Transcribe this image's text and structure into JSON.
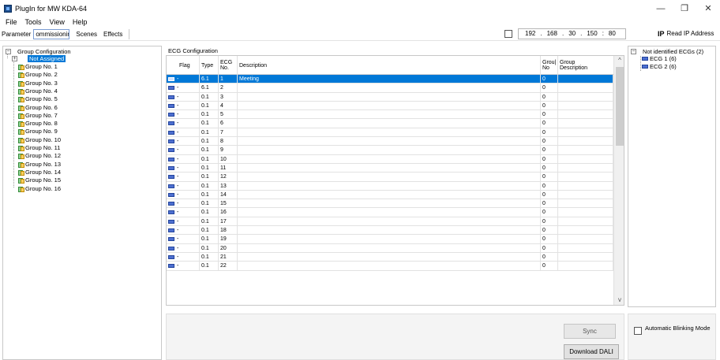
{
  "window": {
    "title": "PlugIn for MW KDA-64",
    "minimize": "—",
    "maximize": "❐",
    "close": "✕"
  },
  "menu": [
    "File",
    "Tools",
    "View",
    "Help"
  ],
  "toolbar": {
    "parameter_label": "Parameter",
    "combo_value": "ommissionir",
    "tabs": [
      "Scenes",
      "Effects"
    ]
  },
  "ip": {
    "enabled": false,
    "octets": [
      "192",
      "168",
      "30",
      "150"
    ],
    "port": "80",
    "read_label": "Read IP Address",
    "icon": "ip-icon"
  },
  "left_tree": {
    "root": "Group Configuration",
    "not_assigned": "Not Assigned",
    "groups": [
      "Group No. 1",
      "Group No. 2",
      "Group No. 3",
      "Group No. 4",
      "Group No. 5",
      "Group No. 6",
      "Group No. 7",
      "Group No. 8",
      "Group No. 9",
      "Group No. 10",
      "Group No. 11",
      "Group No. 12",
      "Group No. 13",
      "Group No. 14",
      "Group No. 15",
      "Group No. 16"
    ]
  },
  "ecg_config": {
    "header": "ECG Configuration",
    "columns": {
      "flag": "Flag",
      "type": "Type",
      "ecg_no_1": "ECG",
      "ecg_no_2": "No.",
      "description": "Description",
      "group_no_1": "Grou|",
      "group_no_2": "No",
      "group_desc_1": "Group",
      "group_desc_2": "Description"
    },
    "rows": [
      {
        "flag": "-",
        "type": "6.1",
        "no": "1",
        "desc": "Meeting",
        "group": "0",
        "gdesc": ""
      },
      {
        "flag": "-",
        "type": "6.1",
        "no": "2",
        "desc": "",
        "group": "0",
        "gdesc": ""
      },
      {
        "flag": "-",
        "type": "0.1",
        "no": "3",
        "desc": "",
        "group": "0",
        "gdesc": ""
      },
      {
        "flag": "-",
        "type": "0.1",
        "no": "4",
        "desc": "",
        "group": "0",
        "gdesc": ""
      },
      {
        "flag": "-",
        "type": "0.1",
        "no": "5",
        "desc": "",
        "group": "0",
        "gdesc": ""
      },
      {
        "flag": "-",
        "type": "0.1",
        "no": "6",
        "desc": "",
        "group": "0",
        "gdesc": ""
      },
      {
        "flag": "-",
        "type": "0.1",
        "no": "7",
        "desc": "",
        "group": "0",
        "gdesc": ""
      },
      {
        "flag": "-",
        "type": "0.1",
        "no": "8",
        "desc": "",
        "group": "0",
        "gdesc": ""
      },
      {
        "flag": "-",
        "type": "0.1",
        "no": "9",
        "desc": "",
        "group": "0",
        "gdesc": ""
      },
      {
        "flag": "-",
        "type": "0.1",
        "no": "10",
        "desc": "",
        "group": "0",
        "gdesc": ""
      },
      {
        "flag": "-",
        "type": "0.1",
        "no": "11",
        "desc": "",
        "group": "0",
        "gdesc": ""
      },
      {
        "flag": "-",
        "type": "0.1",
        "no": "12",
        "desc": "",
        "group": "0",
        "gdesc": ""
      },
      {
        "flag": "-",
        "type": "0.1",
        "no": "13",
        "desc": "",
        "group": "0",
        "gdesc": ""
      },
      {
        "flag": "-",
        "type": "0.1",
        "no": "14",
        "desc": "",
        "group": "0",
        "gdesc": ""
      },
      {
        "flag": "-",
        "type": "0.1",
        "no": "15",
        "desc": "",
        "group": "0",
        "gdesc": ""
      },
      {
        "flag": "-",
        "type": "0.1",
        "no": "16",
        "desc": "",
        "group": "0",
        "gdesc": ""
      },
      {
        "flag": "-",
        "type": "0.1",
        "no": "17",
        "desc": "",
        "group": "0",
        "gdesc": ""
      },
      {
        "flag": "-",
        "type": "0.1",
        "no": "18",
        "desc": "",
        "group": "0",
        "gdesc": ""
      },
      {
        "flag": "-",
        "type": "0.1",
        "no": "19",
        "desc": "",
        "group": "0",
        "gdesc": ""
      },
      {
        "flag": "-",
        "type": "0.1",
        "no": "20",
        "desc": "",
        "group": "0",
        "gdesc": ""
      },
      {
        "flag": "-",
        "type": "0.1",
        "no": "21",
        "desc": "",
        "group": "0",
        "gdesc": ""
      },
      {
        "flag": "-",
        "type": "0.1",
        "no": "22",
        "desc": "",
        "group": "0",
        "gdesc": ""
      }
    ],
    "selected_row": 0
  },
  "right_tree": {
    "root": "Not identified ECGs (2)",
    "items": [
      "ECG 1 (6)",
      "ECG 2 (6)"
    ]
  },
  "buttons": {
    "sync": "Sync",
    "download": "Download DALI"
  },
  "auto_blink": {
    "label": "Automatic Blinking Mode",
    "checked": false
  },
  "colors": {
    "selection": "#0078d7",
    "ecg_icon": "#4d6fd0"
  }
}
